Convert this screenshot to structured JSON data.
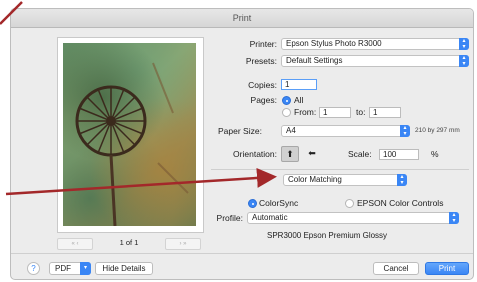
{
  "window": {
    "title": "Print"
  },
  "preview": {
    "page_current": "1",
    "page_total": "1",
    "page_label": "1 of 1",
    "nav_prev": "«  ‹",
    "nav_next": "›  »"
  },
  "printer": {
    "label": "Printer:",
    "value": "Epson Stylus Photo R3000"
  },
  "presets": {
    "label": "Presets:",
    "value": "Default Settings"
  },
  "copies": {
    "label": "Copies:",
    "value": "1"
  },
  "pages": {
    "label": "Pages:",
    "all_label": "All",
    "from_label": "From:",
    "from_value": "1",
    "to_label": "to:",
    "to_value": "1",
    "selected": "All"
  },
  "paper": {
    "label": "Paper Size:",
    "value": "A4",
    "dimensions": "210 by 297 mm"
  },
  "orientation": {
    "label": "Orientation:",
    "selected": "portrait"
  },
  "scale": {
    "label": "Scale:",
    "value": "100",
    "unit": "%"
  },
  "section": {
    "value": "Color Matching"
  },
  "color": {
    "colorsync_label": "ColorSync",
    "epson_label": "EPSON Color Controls",
    "selected": "ColorSync",
    "profile_label": "Profile:",
    "profile_value": "Automatic",
    "profile_info": "SPR3000 Epson Premium Glossy"
  },
  "footer": {
    "help_label": "?",
    "pdf_label": "PDF",
    "hide_details_label": "Hide Details",
    "cancel_label": "Cancel",
    "print_label": "Print"
  },
  "annotation": {
    "color": "#a3282a"
  },
  "colors": {
    "accent": "#3a86f5",
    "dialog_bg": "#ececec"
  }
}
